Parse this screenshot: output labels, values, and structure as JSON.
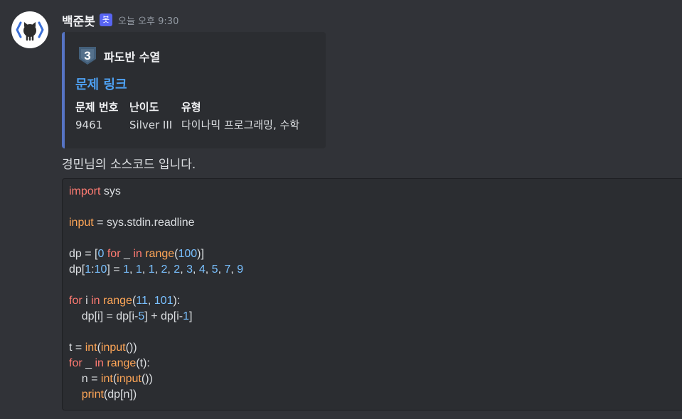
{
  "message": {
    "username": "백준봇",
    "bot_tag": "봇",
    "timestamp": "오늘 오후 9:30",
    "avatar_icon": "github-octocat-icon",
    "content": "경민님의 소스코드 입니다."
  },
  "embed": {
    "accent_color": "#5674c4",
    "tier_number": "3",
    "tier_icon": "silver-tier-icon",
    "title": "파도반 수열",
    "link_text": "문제 링크",
    "fields": [
      {
        "name": "문제 번호",
        "value": "9461"
      },
      {
        "name": "난이도",
        "value": "Silver III"
      },
      {
        "name": "유형",
        "value": "다이나믹 프로그래밍, 수학"
      }
    ]
  },
  "code": {
    "lines": [
      [
        [
          "k",
          "import"
        ],
        [
          "p",
          " sys"
        ]
      ],
      [],
      [
        [
          "f",
          "input"
        ],
        [
          "p",
          " = sys.stdin.readline"
        ]
      ],
      [],
      [
        [
          "p",
          "dp = ["
        ],
        [
          "n",
          "0"
        ],
        [
          "p",
          " "
        ],
        [
          "k",
          "for"
        ],
        [
          "p",
          " _ "
        ],
        [
          "k",
          "in"
        ],
        [
          "p",
          " "
        ],
        [
          "f",
          "range"
        ],
        [
          "p",
          "("
        ],
        [
          "n",
          "100"
        ],
        [
          "p",
          ")]"
        ]
      ],
      [
        [
          "p",
          "dp["
        ],
        [
          "n",
          "1"
        ],
        [
          "p",
          ":"
        ],
        [
          "n",
          "10"
        ],
        [
          "p",
          "] = "
        ],
        [
          "n",
          "1"
        ],
        [
          "p",
          ", "
        ],
        [
          "n",
          "1"
        ],
        [
          "p",
          ", "
        ],
        [
          "n",
          "1"
        ],
        [
          "p",
          ", "
        ],
        [
          "n",
          "2"
        ],
        [
          "p",
          ", "
        ],
        [
          "n",
          "2"
        ],
        [
          "p",
          ", "
        ],
        [
          "n",
          "3"
        ],
        [
          "p",
          ", "
        ],
        [
          "n",
          "4"
        ],
        [
          "p",
          ", "
        ],
        [
          "n",
          "5"
        ],
        [
          "p",
          ", "
        ],
        [
          "n",
          "7"
        ],
        [
          "p",
          ", "
        ],
        [
          "n",
          "9"
        ]
      ],
      [],
      [
        [
          "k",
          "for"
        ],
        [
          "p",
          " i "
        ],
        [
          "k",
          "in"
        ],
        [
          "p",
          " "
        ],
        [
          "f",
          "range"
        ],
        [
          "p",
          "("
        ],
        [
          "n",
          "11"
        ],
        [
          "p",
          ", "
        ],
        [
          "n",
          "101"
        ],
        [
          "p",
          "):"
        ]
      ],
      [
        [
          "p",
          "    dp[i] = dp[i-"
        ],
        [
          "n",
          "5"
        ],
        [
          "p",
          "] + dp[i-"
        ],
        [
          "n",
          "1"
        ],
        [
          "p",
          "]"
        ]
      ],
      [],
      [
        [
          "p",
          "t = "
        ],
        [
          "f",
          "int"
        ],
        [
          "p",
          "("
        ],
        [
          "f",
          "input"
        ],
        [
          "p",
          "())"
        ]
      ],
      [
        [
          "k",
          "for"
        ],
        [
          "p",
          " _ "
        ],
        [
          "k",
          "in"
        ],
        [
          "p",
          " "
        ],
        [
          "f",
          "range"
        ],
        [
          "p",
          "(t):"
        ]
      ],
      [
        [
          "p",
          "    n = "
        ],
        [
          "f",
          "int"
        ],
        [
          "p",
          "("
        ],
        [
          "f",
          "input"
        ],
        [
          "p",
          "())"
        ]
      ],
      [
        [
          "p",
          "    "
        ],
        [
          "f",
          "print"
        ],
        [
          "p",
          "(dp[n])"
        ]
      ]
    ]
  }
}
